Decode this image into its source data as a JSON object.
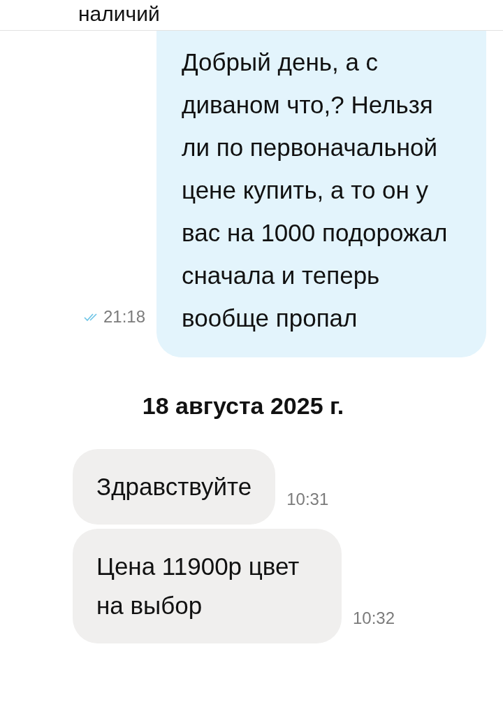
{
  "top_cut_text": "наличий",
  "messages": [
    {
      "kind": "outgoing",
      "text": "Добрый день, а с диваном что,? Нельзя ли по первоначальной цене купить, а то он у вас на 1000 подорожал сначала и теперь вообще пропал",
      "time": "21:18",
      "read": true
    },
    {
      "kind": "date",
      "text": "18 августа 2025 г."
    },
    {
      "kind": "incoming",
      "text": "Здравствуйте",
      "time": "10:31"
    },
    {
      "kind": "incoming",
      "text": "Цена 11900р цвет на выбор",
      "time": "10:32"
    }
  ]
}
